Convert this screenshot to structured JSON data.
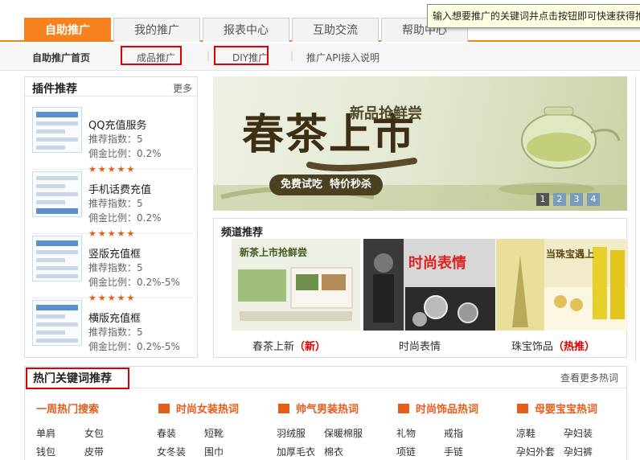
{
  "tabs": [
    {
      "label": "自助推广",
      "active": true
    },
    {
      "label": "我的推广",
      "active": false
    },
    {
      "label": "报表中心",
      "active": false
    },
    {
      "label": "互助交流",
      "active": false
    },
    {
      "label": "帮助中心",
      "active": false
    }
  ],
  "tooltip": "输入想要推广的关键词并点击按钮即可快速获得推广链接",
  "subnav": {
    "home": "自助推广首页",
    "items": [
      "成品推广",
      "DIY推广",
      "推广API接入说明"
    ]
  },
  "plugins": {
    "title": "插件推荐",
    "more": "更多",
    "items": [
      {
        "name": "QQ充值服务",
        "index": "推荐指数：5",
        "ratio": "佣金比例：0.2%"
      },
      {
        "name": "手机话费充值",
        "index": "推荐指数：5",
        "ratio": "佣金比例：0.2%"
      },
      {
        "name": "竖版充值框",
        "index": "推荐指数：5",
        "ratio": "佣金比例：0.2%-5%"
      },
      {
        "name": "横版充值框",
        "index": "推荐指数：5",
        "ratio": "佣金比例：0.2%-5%"
      }
    ],
    "stars": "★★★★★"
  },
  "banner": {
    "title": "春茶上市",
    "subtitle": "新品抢鲜尝",
    "slogan": "免费试吃  特价秒杀",
    "pages": [
      "1",
      "2",
      "3",
      "4"
    ]
  },
  "channel": {
    "title": "频道推荐",
    "items": [
      {
        "caption": "春茶上新",
        "tag": "（新）",
        "img_text": "新茶上市抢鲜尝"
      },
      {
        "caption": "时尚表情",
        "tag": "",
        "img_text": "时尚表情"
      },
      {
        "caption": "珠宝饰品",
        "tag": "（热推）",
        "img_text": "当珠宝遇上"
      }
    ]
  },
  "hot": {
    "title": "热门关键词推荐",
    "more": "查看更多热词",
    "categories": [
      {
        "label": "一周热门搜索",
        "words": [
          "单肩",
          "女包",
          "钱包",
          "皮带"
        ]
      },
      {
        "label": "时尚女装热词",
        "words": [
          "春装",
          "短靴",
          "女冬装",
          "围巾"
        ]
      },
      {
        "label": "帅气男装热词",
        "words": [
          "羽绒服",
          "保暖棉服",
          "加厚毛衣",
          "棉衣"
        ]
      },
      {
        "label": "时尚饰品热词",
        "words": [
          "礼物",
          "戒指",
          "项链",
          "手链"
        ]
      },
      {
        "label": "母婴宝宝热词",
        "words": [
          "凉鞋",
          "孕妇装",
          "孕妇外套",
          "孕妇裤"
        ]
      }
    ]
  },
  "colors": {
    "accent": "#f5821f",
    "highlight": "#d00000",
    "hotword": "#e65c1a"
  }
}
